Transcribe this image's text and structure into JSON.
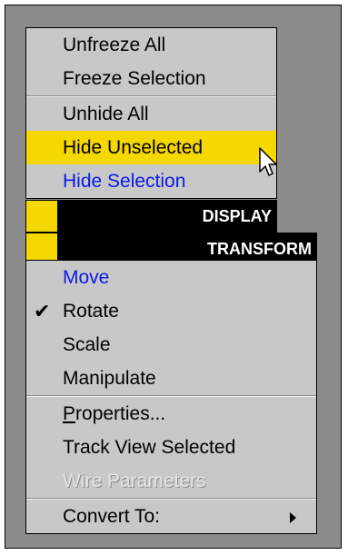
{
  "menu_top": [
    {
      "label": "Unfreeze All"
    },
    {
      "label": "Freeze Selection"
    },
    {
      "label": "Unhide All"
    },
    {
      "label": "Hide Unselected"
    },
    {
      "label": "Hide Selection"
    }
  ],
  "quads": [
    {
      "label": "DISPLAY"
    },
    {
      "label": "TRANSFORM"
    }
  ],
  "menu_bottom": [
    {
      "label": "Move"
    },
    {
      "label": "Rotate"
    },
    {
      "label": "Scale"
    },
    {
      "label": "Manipulate"
    },
    {
      "label_first": "P",
      "label_rest": "roperties..."
    },
    {
      "label": "Track View Selected"
    },
    {
      "label": "Wire Parameters"
    },
    {
      "label": "Convert To:"
    }
  ],
  "colors": {
    "highlight": "#f5d800",
    "active_blue": "#0a1ae8",
    "menu_bg": "#c8c8c8",
    "backdrop": "#8c8c8c"
  },
  "icons": {
    "check": "checkmark-icon",
    "submenu": "submenu-arrow-icon",
    "cursor": "mouse-pointer-icon"
  }
}
